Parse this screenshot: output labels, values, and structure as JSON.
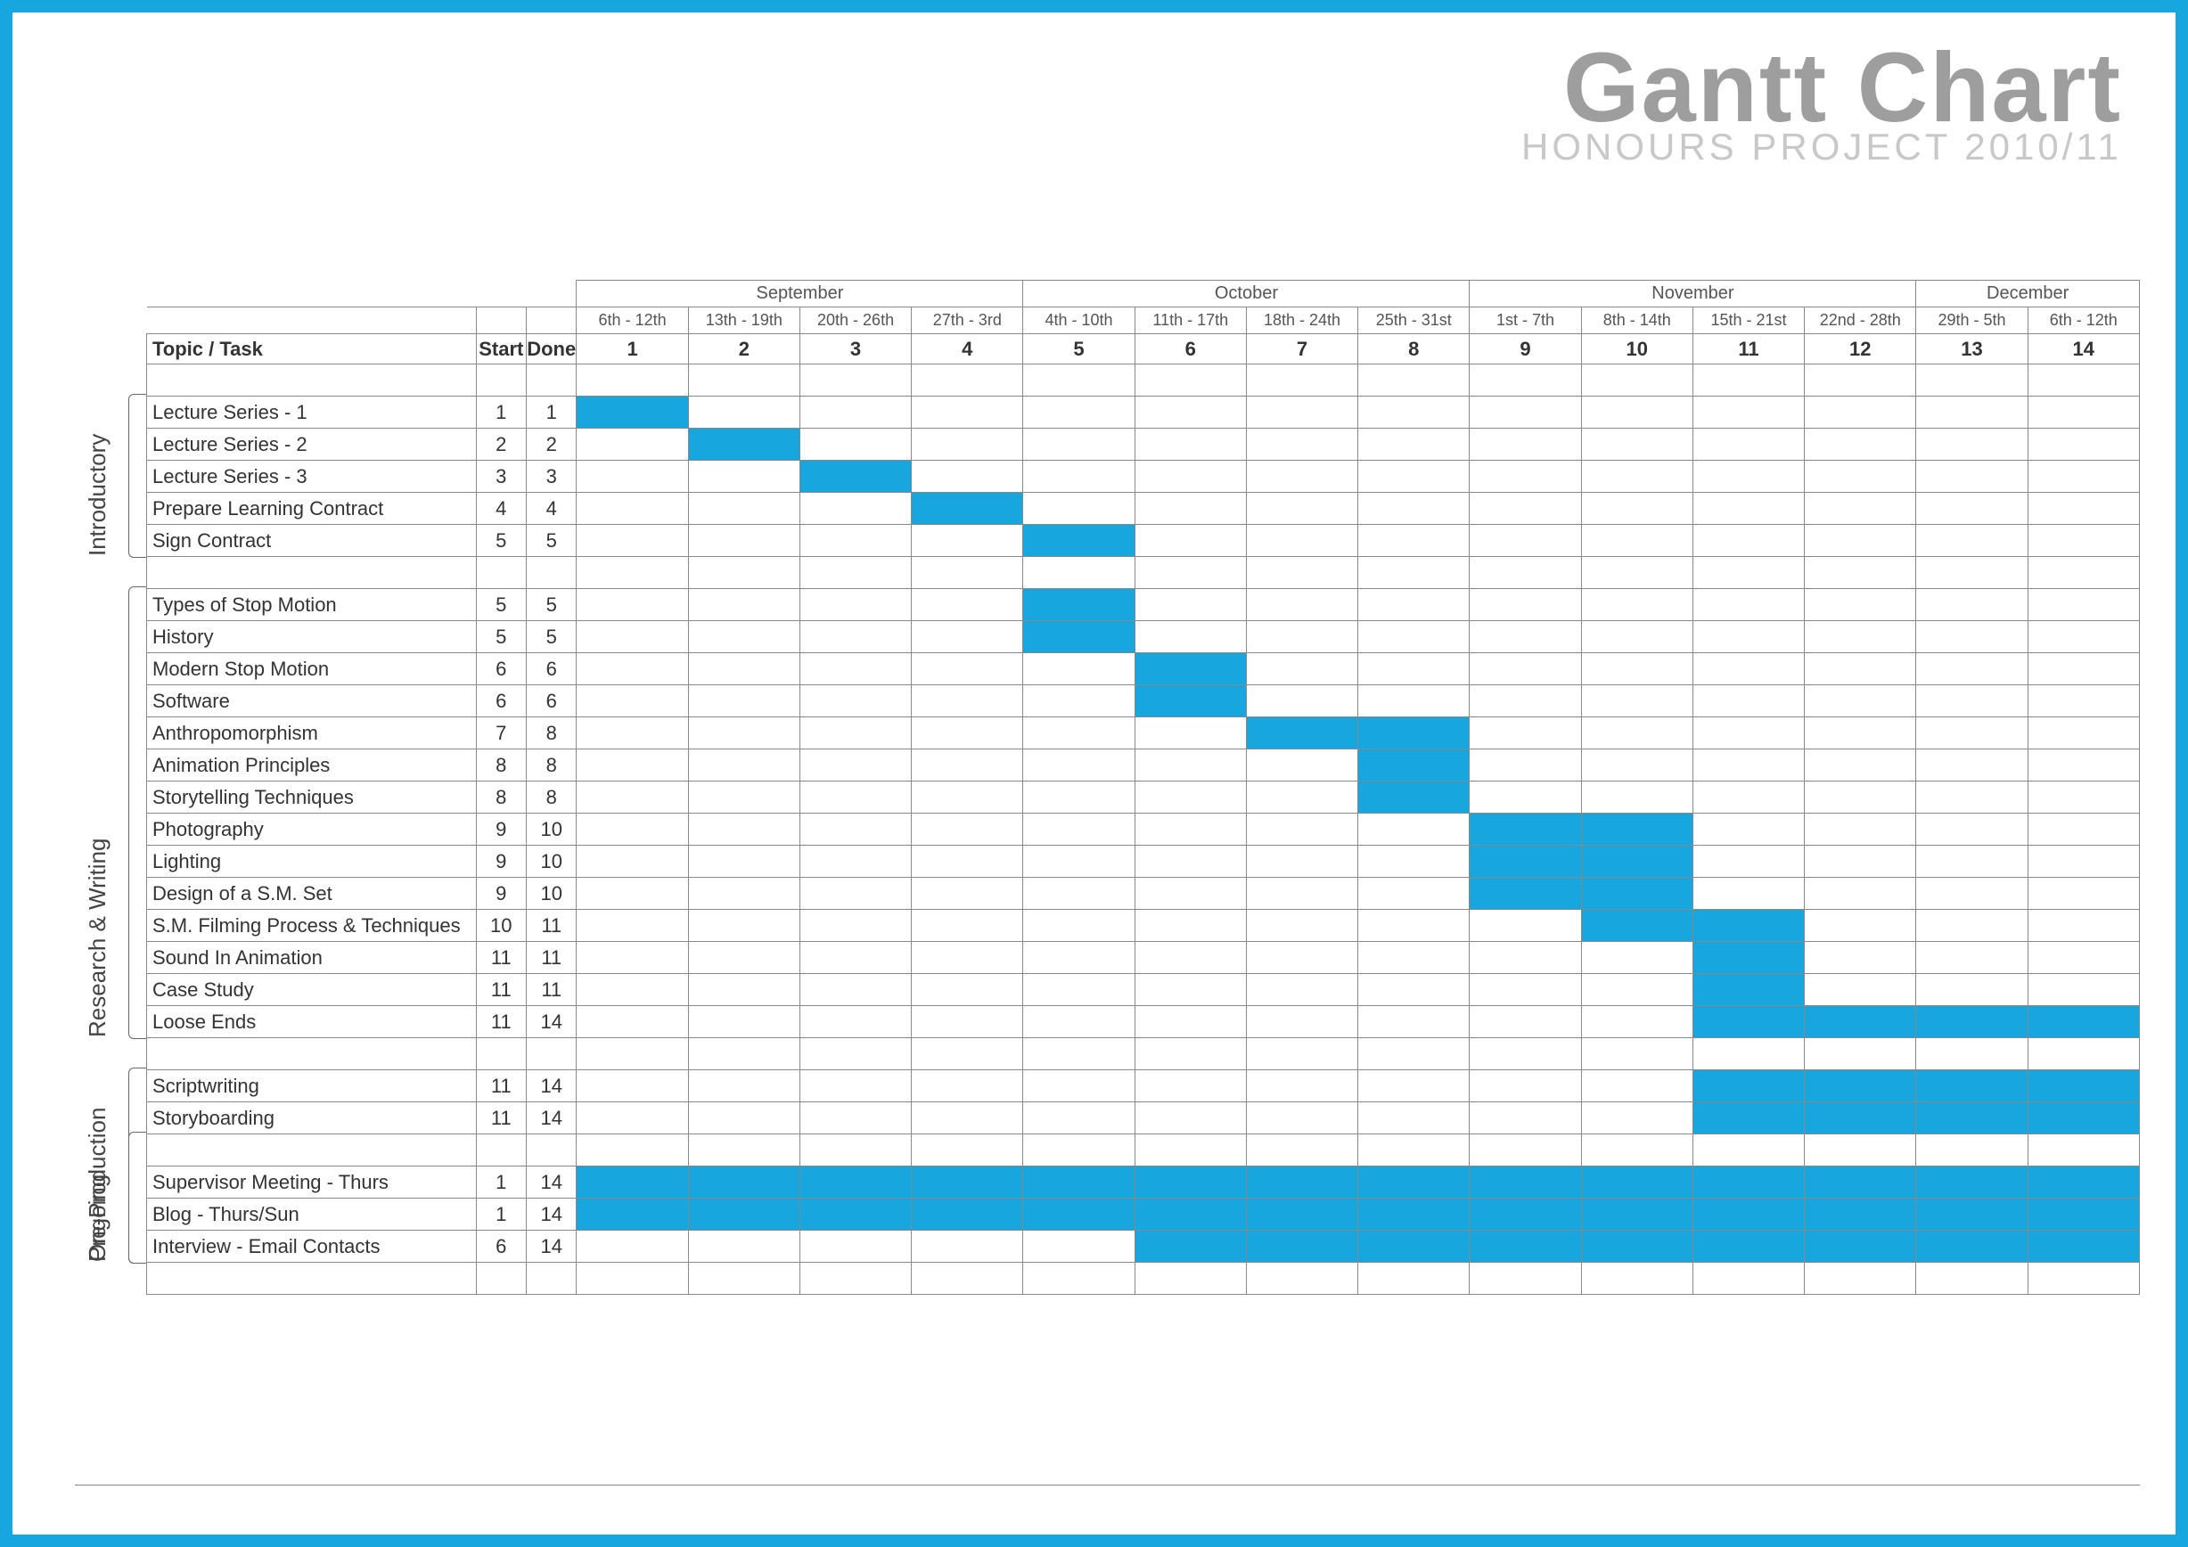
{
  "title": {
    "main": "Gantt Chart",
    "sub": "HONOURS PROJECT 2010/11"
  },
  "header": {
    "topic_label": "Topic / Task",
    "start_label": "Start",
    "done_label": "Done"
  },
  "months": [
    {
      "name": "September",
      "span": 4
    },
    {
      "name": "October",
      "span": 4
    },
    {
      "name": "November",
      "span": 4
    },
    {
      "name": "December",
      "span": 2
    }
  ],
  "week_ranges": [
    "6th - 12th",
    "13th - 19th",
    "20th - 26th",
    "27th - 3rd",
    "4th - 10th",
    "11th - 17th",
    "18th - 24th",
    "25th - 31st",
    "1st - 7th",
    "8th - 14th",
    "15th - 21st",
    "22nd - 28th",
    "29th - 5th",
    "6th - 12th"
  ],
  "week_numbers": [
    "1",
    "2",
    "3",
    "4",
    "5",
    "6",
    "7",
    "8",
    "9",
    "10",
    "11",
    "12",
    "13",
    "14"
  ],
  "sections": [
    {
      "label": "Introductory",
      "row_start": 1,
      "rows": 5
    },
    {
      "label": "Research & Writing",
      "row_start": 7,
      "rows": 14
    },
    {
      "label": "Pre-Production",
      "row_start": 22,
      "rows": 6
    },
    {
      "label": "Ongoing",
      "row_start": 24,
      "rows": 4
    }
  ],
  "chart_data": {
    "type": "gantt",
    "weeks": 14,
    "rows": [
      {
        "kind": "spacer"
      },
      {
        "kind": "task",
        "name": "Lecture Series - 1",
        "start": 1,
        "done": 1
      },
      {
        "kind": "task",
        "name": "Lecture Series - 2",
        "start": 2,
        "done": 2
      },
      {
        "kind": "task",
        "name": "Lecture Series - 3",
        "start": 3,
        "done": 3
      },
      {
        "kind": "task",
        "name": "Prepare Learning Contract",
        "start": 4,
        "done": 4
      },
      {
        "kind": "task",
        "name": "Sign Contract",
        "start": 5,
        "done": 5
      },
      {
        "kind": "spacer"
      },
      {
        "kind": "task",
        "name": "Types of Stop Motion",
        "start": 5,
        "done": 5
      },
      {
        "kind": "task",
        "name": "History",
        "start": 5,
        "done": 5
      },
      {
        "kind": "task",
        "name": "Modern Stop Motion",
        "start": 6,
        "done": 6
      },
      {
        "kind": "task",
        "name": "Software",
        "start": 6,
        "done": 6
      },
      {
        "kind": "task",
        "name": "Anthropomorphism",
        "start": 7,
        "done": 8
      },
      {
        "kind": "task",
        "name": "Animation Principles",
        "start": 8,
        "done": 8
      },
      {
        "kind": "task",
        "name": "Storytelling Techniques",
        "start": 8,
        "done": 8
      },
      {
        "kind": "task",
        "name": "Photography",
        "start": 9,
        "done": 10
      },
      {
        "kind": "task",
        "name": "Lighting",
        "start": 9,
        "done": 10
      },
      {
        "kind": "task",
        "name": "Design of a S.M. Set",
        "start": 9,
        "done": 10
      },
      {
        "kind": "task",
        "name": "S.M. Filming Process & Techniques",
        "start": 10,
        "done": 11
      },
      {
        "kind": "task",
        "name": "Sound In Animation",
        "start": 11,
        "done": 11
      },
      {
        "kind": "task",
        "name": "Case Study",
        "start": 11,
        "done": 11
      },
      {
        "kind": "task",
        "name": "Loose Ends",
        "start": 11,
        "done": 14
      },
      {
        "kind": "spacer"
      },
      {
        "kind": "task",
        "name": "Scriptwriting",
        "start": 11,
        "done": 14
      },
      {
        "kind": "task",
        "name": "Storyboarding",
        "start": 11,
        "done": 14
      },
      {
        "kind": "spacer"
      },
      {
        "kind": "task",
        "name": "Supervisor Meeting - Thurs",
        "start": 1,
        "done": 14
      },
      {
        "kind": "task",
        "name": "Blog - Thurs/Sun",
        "start": 1,
        "done": 14
      },
      {
        "kind": "task",
        "name": "Interview - Email Contacts",
        "start": 6,
        "done": 14
      },
      {
        "kind": "spacer"
      }
    ]
  }
}
